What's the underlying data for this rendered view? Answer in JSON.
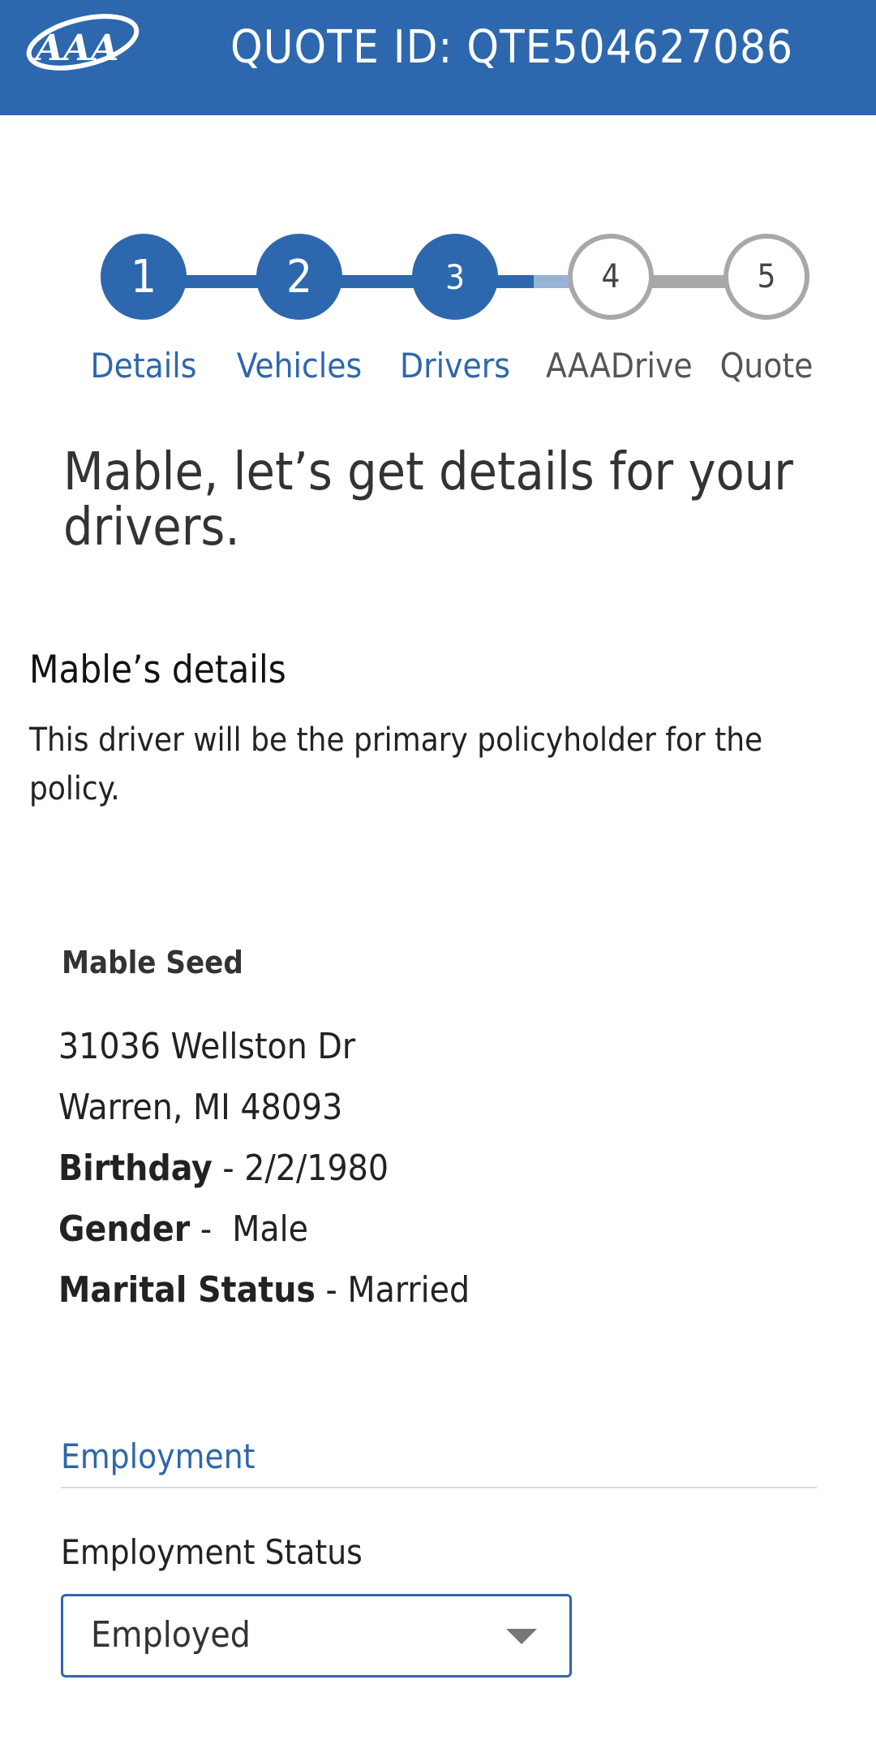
{
  "header": {
    "logo_text": "AAA",
    "quote_id_text": "QUOTE ID: QTE504627086",
    "background_color": "#2d67ad"
  },
  "stepper": {
    "current_step": 3,
    "steps": [
      {
        "number": "1",
        "label": "Details",
        "state": "completed"
      },
      {
        "number": "2",
        "label": "Vehicles",
        "state": "completed"
      },
      {
        "number": "3",
        "label": "Drivers",
        "state": "current"
      },
      {
        "number": "4",
        "label": "AAADrive",
        "state": "upcoming"
      },
      {
        "number": "5",
        "label": "Quote",
        "state": "upcoming"
      }
    ],
    "active_color": "#2d67ad",
    "inactive_color": "#a8a8a8"
  },
  "main": {
    "headline": "Mable, let’s get details for your drivers.",
    "section_title": "Mable’s details",
    "section_description": "This driver will be the primary policyholder for the policy."
  },
  "driver": {
    "name": "Mable Seed",
    "address_line1": "31036 Wellston Dr",
    "address_line2": "Warren, MI 48093",
    "birthday_label": "Birthday",
    "birthday_value": " - 2/2/1980",
    "gender_label": "Gender",
    "gender_value": " -  Male",
    "marital_label": "Marital Status",
    "marital_value": " - Married"
  },
  "employment": {
    "heading": "Employment",
    "status_label": "Employment Status",
    "status_value": "Employed"
  }
}
